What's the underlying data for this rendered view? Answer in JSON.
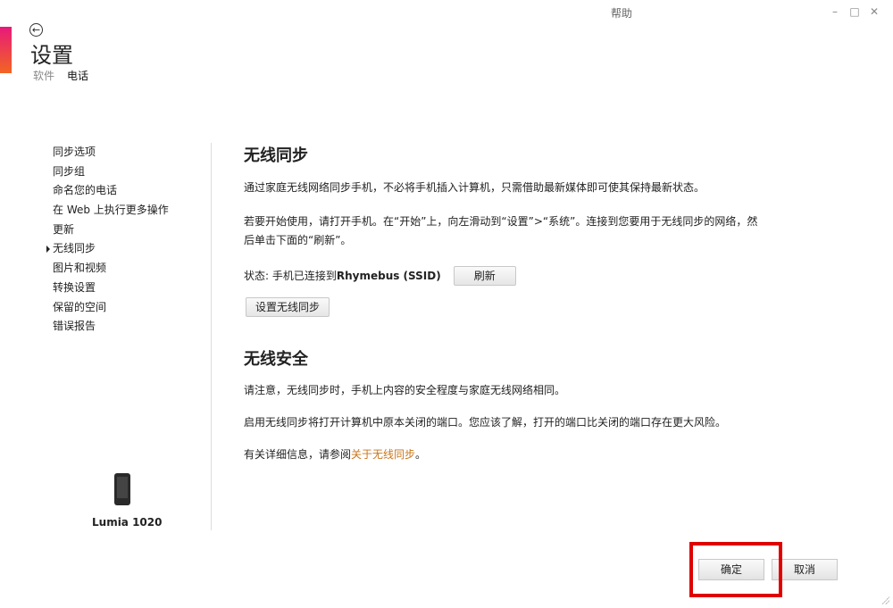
{
  "window": {
    "help_label": "帮助",
    "minimize_glyph": "–",
    "maximize_glyph": "□",
    "close_glyph": "✕"
  },
  "header": {
    "title": "设置",
    "tabs": [
      {
        "label": "软件"
      },
      {
        "label": "电话"
      }
    ],
    "active_tab": "电话",
    "accent_gradient": [
      "#e8197a",
      "#f26522"
    ]
  },
  "sidebar": {
    "items": [
      {
        "label": "同步选项"
      },
      {
        "label": "同步组"
      },
      {
        "label": "命名您的电话"
      },
      {
        "label": "在 Web 上执行更多操作"
      },
      {
        "label": "更新"
      },
      {
        "label": "无线同步"
      },
      {
        "label": "图片和视频"
      },
      {
        "label": "转换设置"
      },
      {
        "label": "保留的空间"
      },
      {
        "label": "错误报告"
      }
    ],
    "selected": "无线同步",
    "device_name": "Lumia 1020"
  },
  "wireless_sync": {
    "heading": "无线同步",
    "intro": "通过家庭无线网络同步手机，不必将手机插入计算机，只需借助最新媒体即可使其保持最新状态。",
    "instructions_line1": "若要开始使用，请打开手机。在“开始”上，向左滑动到“设置”>“系统”。连接到您要用于无线同步的网络，然",
    "instructions_line2": "后单击下面的“刷新”。",
    "status_prefix": "状态: 手机已连接到 ",
    "status_network": "Rhymebus (SSID)",
    "refresh_label": "刷新",
    "setup_label": "设置无线同步"
  },
  "wireless_security": {
    "heading": "无线安全",
    "note": "请注意，无线同步时，手机上内容的安全程度与家庭无线网络相同。",
    "ports": "启用无线同步将打开计算机中原本关闭的端口。您应该了解，打开的端口比关闭的端口存在更大风险。",
    "more_prefix": "有关详细信息，请参阅",
    "more_link": "关于无线同步",
    "more_suffix": "。",
    "link_color": "#c8761a"
  },
  "footer": {
    "ok_label": "确定",
    "cancel_label": "取消",
    "highlight_color": "#e00000"
  }
}
